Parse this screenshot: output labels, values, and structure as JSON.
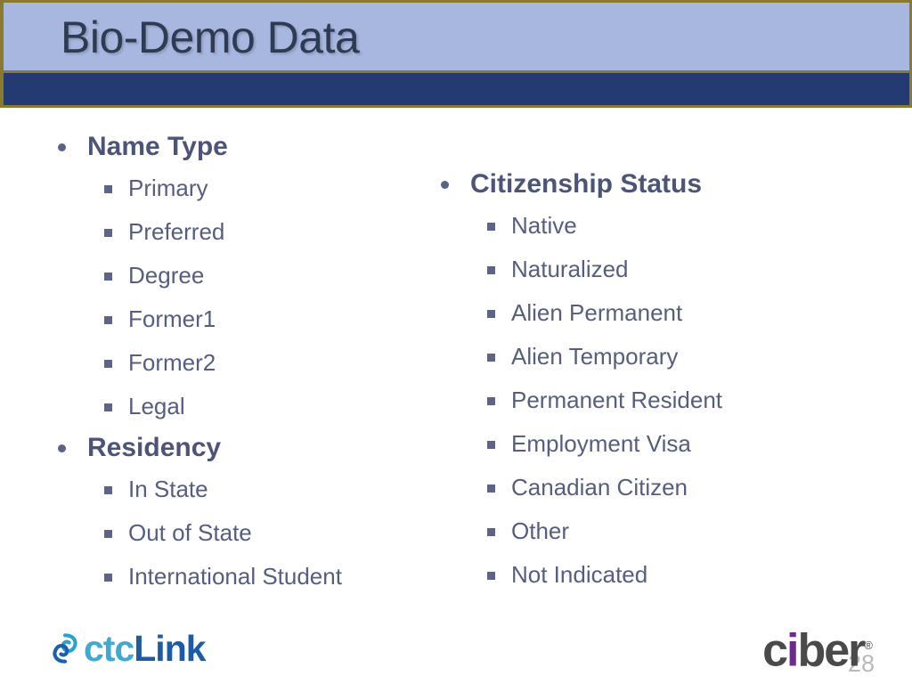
{
  "slide": {
    "title": "Bio-Demo Data",
    "slide_number": "28",
    "colors": {
      "header_band": "#a7b7df",
      "header_accent_bar": "#243a73",
      "header_border": "#8a7a2e",
      "title_text": "#2f3a53",
      "heading_text": "#4c5478",
      "body_text": "#565e80",
      "bullet": "#5a6287",
      "background": "#ffffff"
    }
  },
  "left_column": {
    "groups": [
      {
        "heading": "Name Type",
        "bullet_icon": "round-bullet-icon",
        "items": [
          {
            "label": "Primary",
            "bullet_icon": "square-bullet-icon"
          },
          {
            "label": "Preferred",
            "bullet_icon": "square-bullet-icon"
          },
          {
            "label": "Degree",
            "bullet_icon": "square-bullet-icon"
          },
          {
            "label": "Former1",
            "bullet_icon": "square-bullet-icon"
          },
          {
            "label": "Former2",
            "bullet_icon": "square-bullet-icon"
          },
          {
            "label": "Legal",
            "bullet_icon": "square-bullet-icon"
          }
        ]
      },
      {
        "heading": "Residency",
        "bullet_icon": "round-bullet-icon",
        "items": [
          {
            "label": "In State",
            "bullet_icon": "square-bullet-icon"
          },
          {
            "label": "Out of State",
            "bullet_icon": "square-bullet-icon"
          },
          {
            "label": "International Student",
            "bullet_icon": "square-bullet-icon"
          }
        ]
      }
    ]
  },
  "right_column": {
    "groups": [
      {
        "heading": "Citizenship Status",
        "bullet_icon": "round-bullet-icon",
        "items": [
          {
            "label": "Native",
            "bullet_icon": "square-bullet-icon"
          },
          {
            "label": "Naturalized",
            "bullet_icon": "square-bullet-icon"
          },
          {
            "label": "Alien Permanent",
            "bullet_icon": "square-bullet-icon"
          },
          {
            "label": "Alien Temporary",
            "bullet_icon": "square-bullet-icon"
          },
          {
            "label": "Permanent Resident",
            "bullet_icon": "square-bullet-icon"
          },
          {
            "label": "Employment Visa",
            "bullet_icon": "square-bullet-icon"
          },
          {
            "label": "Canadian Citizen",
            "bullet_icon": "square-bullet-icon"
          },
          {
            "label": "Other",
            "bullet_icon": "square-bullet-icon"
          },
          {
            "label": "Not Indicated",
            "bullet_icon": "square-bullet-icon"
          }
        ]
      }
    ]
  },
  "footer": {
    "ctclink_logo": {
      "icon": "ctclink-swirl-icon",
      "text_part1": "ctc",
      "text_part2": "Link",
      "color_part1": "#3fa9d4",
      "color_part2": "#1d5ba4"
    },
    "ciber_logo": {
      "text_c": "c",
      "text_i": "i",
      "text_ber": "ber",
      "registered_mark": "®",
      "color_c": "#4a4a4a",
      "color_i": "#6d2a8f"
    }
  }
}
